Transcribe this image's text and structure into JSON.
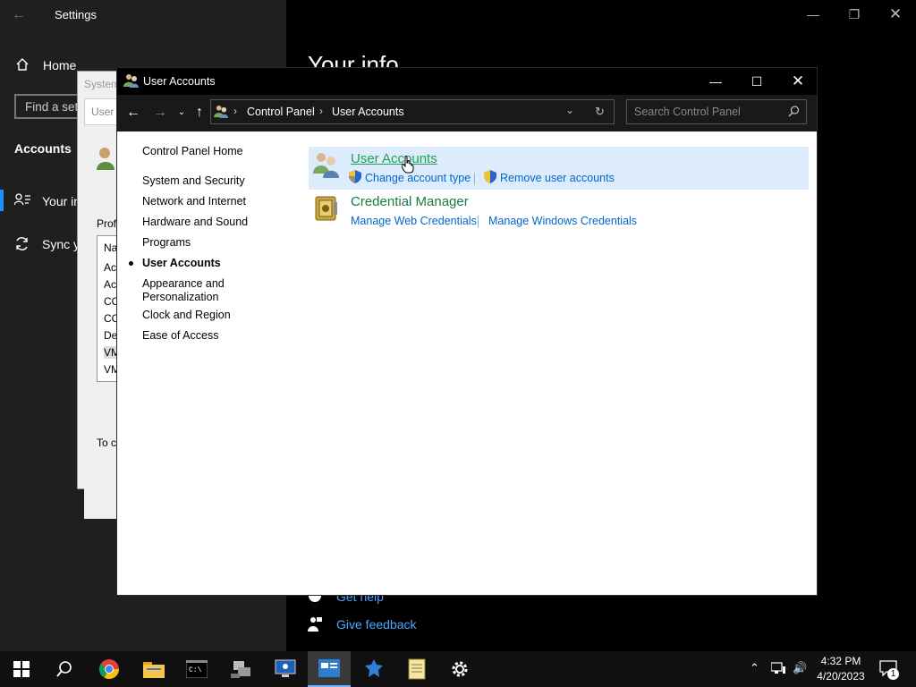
{
  "settings": {
    "title": "Settings",
    "home_label": "Home",
    "search_placeholder": "Find a set",
    "section_title": "Accounts",
    "nav_items": [
      {
        "label": "Your in"
      },
      {
        "label": "Sync y"
      }
    ],
    "page_heading": "Your info",
    "help_label": "Get help",
    "feedback_label": "Give feedback"
  },
  "sysprops": {
    "title": "System",
    "tab": "User",
    "profiles_label": "Prof",
    "list_items": [
      "Na",
      "Ac",
      "Ac",
      "CC",
      "CC",
      "De",
      "VM",
      "VM"
    ],
    "footer_text": "To c"
  },
  "control_panel": {
    "title": "User Accounts",
    "breadcrumb": [
      "Control Panel",
      "User Accounts"
    ],
    "search_placeholder": "Search Control Panel",
    "left_nav": {
      "home": "Control Panel Home",
      "items": [
        {
          "label": "System and Security",
          "active": false
        },
        {
          "label": "Network and Internet",
          "active": false
        },
        {
          "label": "Hardware and Sound",
          "active": false
        },
        {
          "label": "Programs",
          "active": false
        },
        {
          "label": "User Accounts",
          "active": true
        },
        {
          "label": "Appearance and Personalization",
          "active": false
        },
        {
          "label": "Clock and Region",
          "active": false
        },
        {
          "label": "Ease of Access",
          "active": false
        }
      ]
    },
    "categories": [
      {
        "title": "User Accounts",
        "links": [
          "Change account type",
          "Remove user accounts"
        ]
      },
      {
        "title": "Credential Manager",
        "links": [
          "Manage Web Credentials",
          "Manage Windows Credentials"
        ]
      }
    ]
  },
  "taskbar": {
    "apps": [
      "Chrome",
      "File Explorer",
      "Command Prompt",
      "Network app",
      "Remote Desktop",
      "Control Panel",
      "App",
      "Notepad",
      "Settings"
    ],
    "time": "4:32 PM",
    "date": "4/20/2023",
    "notification_count": "1"
  },
  "colors": {
    "accent": "#1a7a43",
    "link": "#0066cc",
    "highlight": "#dcecfc"
  }
}
